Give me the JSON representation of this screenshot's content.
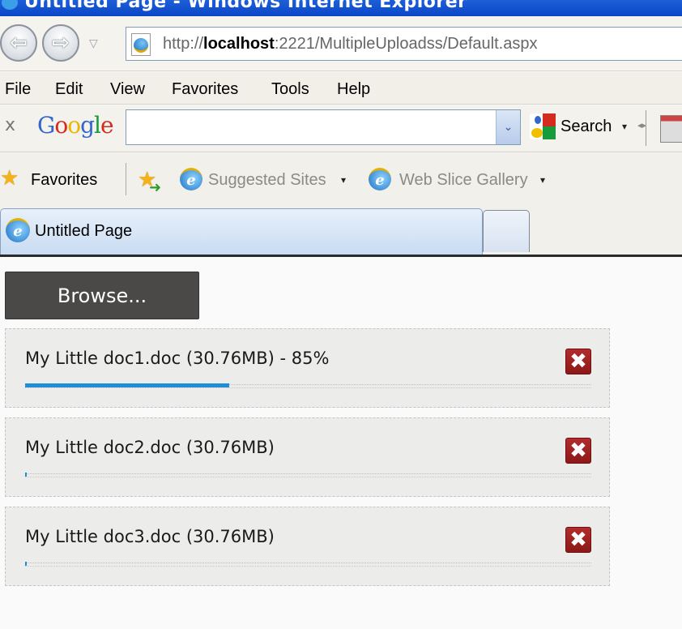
{
  "window": {
    "title": "Untitled Page - Windows Internet Explorer"
  },
  "address_bar": {
    "url_prefix": "http://",
    "url_host": "localhost",
    "url_rest": ":2221/MultipleUploadss/Default.aspx",
    "back_icon": "back-arrow-icon",
    "forward_icon": "forward-arrow-icon",
    "recent_pages_icon": "dropdown-triangle-icon"
  },
  "menu": {
    "items": [
      {
        "label": "File"
      },
      {
        "label": "Edit"
      },
      {
        "label": "View"
      },
      {
        "label": "Favorites"
      },
      {
        "label": "Tools"
      },
      {
        "label": "Help"
      }
    ]
  },
  "google_toolbar": {
    "close_label": "x",
    "logo": [
      "G",
      "o",
      "o",
      "g",
      "l",
      "e"
    ],
    "logo_colors": [
      "#3366cc",
      "#d52b1e",
      "#e8b800",
      "#3366cc",
      "#179b3b",
      "#d52b1e"
    ],
    "search_value": "",
    "search_dropdown_glyph": "⌄",
    "search_button_label": "Search",
    "search_button_arrow": "▾",
    "resize_glyph": "◂▸"
  },
  "favorites_bar": {
    "favorites_label": "Favorites",
    "links": [
      {
        "label": "Suggested Sites",
        "arrow": "▾"
      },
      {
        "label": "Web Slice Gallery",
        "arrow": "▾"
      }
    ]
  },
  "tabs": {
    "active_label": "Untitled Page"
  },
  "page": {
    "browse_label": "Browse...",
    "remove_glyph": "✖",
    "accent_color": "#1e8fd6",
    "remove_color": "#9e2020",
    "files": [
      {
        "name": "My Little doc1.doc (30.76MB) - 85%",
        "progress_fill_fraction": 0.36
      },
      {
        "name": "My Little doc2.doc (30.76MB)",
        "progress_fill_fraction": 0.003
      },
      {
        "name": "My Little doc3.doc (30.76MB)",
        "progress_fill_fraction": 0.003
      }
    ]
  }
}
